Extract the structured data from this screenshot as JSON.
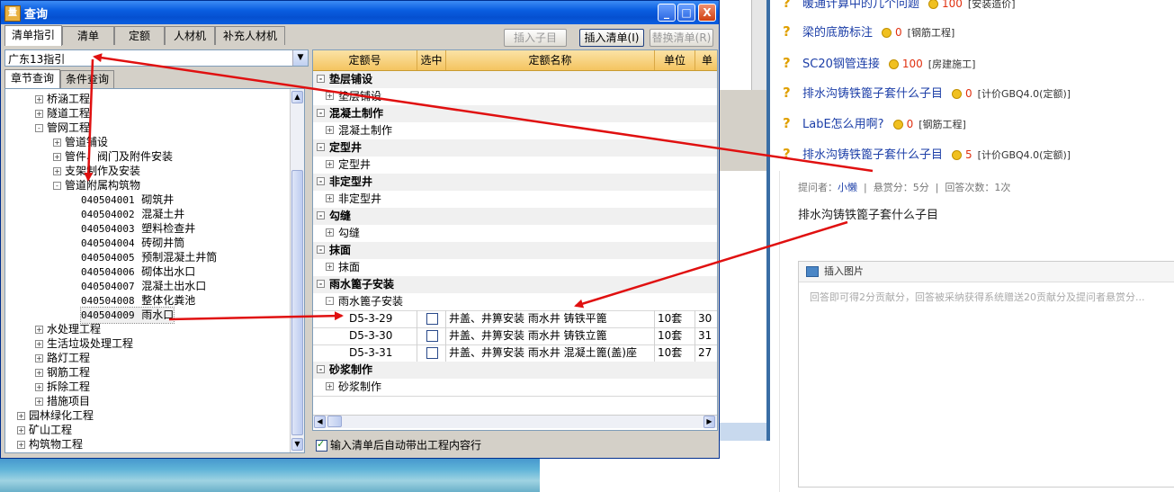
{
  "window": {
    "title": "查询",
    "min_label": "_",
    "max_label": "□",
    "close_label": "X"
  },
  "tabs": [
    "清单指引",
    "清单",
    "定额",
    "人材机",
    "补充人材机"
  ],
  "toolbar": {
    "insert_child": "插入子目",
    "insert_list": "插入清单(I)",
    "replace_list": "替换清单(R)"
  },
  "region_select": "广东13指引",
  "subtabs": [
    "章节查询",
    "条件查询"
  ],
  "tree": [
    {
      "label": "桥涵工程",
      "level": 1,
      "sign": "+"
    },
    {
      "label": "隧道工程",
      "level": 1,
      "sign": "+"
    },
    {
      "label": "管网工程",
      "level": 1,
      "sign": "-"
    },
    {
      "label": "管道铺设",
      "level": 2,
      "sign": "+"
    },
    {
      "label": "管件、阀门及附件安装",
      "level": 2,
      "sign": "+"
    },
    {
      "label": "支架制作及安装",
      "level": 2,
      "sign": "+"
    },
    {
      "label": "管道附属构筑物",
      "level": 2,
      "sign": "-"
    },
    {
      "code": "040504001",
      "label": "砌筑井",
      "level": 3
    },
    {
      "code": "040504002",
      "label": "混凝土井",
      "level": 3
    },
    {
      "code": "040504003",
      "label": "塑料检查井",
      "level": 3
    },
    {
      "code": "040504004",
      "label": "砖砌井筒",
      "level": 3
    },
    {
      "code": "040504005",
      "label": "预制混凝土井筒",
      "level": 3
    },
    {
      "code": "040504006",
      "label": "砌体出水口",
      "level": 3
    },
    {
      "code": "040504007",
      "label": "混凝土出水口",
      "level": 3
    },
    {
      "code": "040504008",
      "label": "整体化粪池",
      "level": 3
    },
    {
      "code": "040504009",
      "label": "雨水口",
      "level": 3,
      "selected": true
    },
    {
      "label": "水处理工程",
      "level": 1,
      "sign": "+"
    },
    {
      "label": "生活垃圾处理工程",
      "level": 1,
      "sign": "+"
    },
    {
      "label": "路灯工程",
      "level": 1,
      "sign": "+"
    },
    {
      "label": "钢筋工程",
      "level": 1,
      "sign": "+"
    },
    {
      "label": "拆除工程",
      "level": 1,
      "sign": "+"
    },
    {
      "label": "措施项目",
      "level": 1,
      "sign": "+"
    },
    {
      "label": "园林绿化工程",
      "level": 0,
      "sign": "+"
    },
    {
      "label": "矿山工程",
      "level": 0,
      "sign": "+"
    },
    {
      "label": "构筑物工程",
      "level": 0,
      "sign": "+"
    }
  ],
  "grid": {
    "headers": [
      "定额号",
      "选中",
      "定额名称",
      "单位",
      "单"
    ],
    "rows": [
      {
        "type": "grp",
        "label": "垫层铺设",
        "sign": "-"
      },
      {
        "type": "sub",
        "label": "垫层铺设",
        "sign": "+"
      },
      {
        "type": "grp",
        "label": "混凝土制作",
        "sign": "-"
      },
      {
        "type": "sub",
        "label": "混凝土制作",
        "sign": "+"
      },
      {
        "type": "grp",
        "label": "定型井",
        "sign": "-"
      },
      {
        "type": "sub",
        "label": "定型井",
        "sign": "+"
      },
      {
        "type": "grp",
        "label": "非定型井",
        "sign": "-"
      },
      {
        "type": "sub",
        "label": "非定型井",
        "sign": "+"
      },
      {
        "type": "grp",
        "label": "勾缝",
        "sign": "-"
      },
      {
        "type": "sub",
        "label": "勾缝",
        "sign": "+"
      },
      {
        "type": "grp",
        "label": "抹面",
        "sign": "-"
      },
      {
        "type": "sub",
        "label": "抹面",
        "sign": "+"
      },
      {
        "type": "grp",
        "label": "雨水篦子安装",
        "sign": "-"
      },
      {
        "type": "sub",
        "label": "雨水篦子安装",
        "sign": "-"
      },
      {
        "type": "item",
        "code": "D5-3-29",
        "name": "井盖、井箅安装 雨水井 铸铁平篦",
        "unit": "10套",
        "price": "30"
      },
      {
        "type": "item",
        "code": "D5-3-30",
        "name": "井盖、井箅安装 雨水井 铸铁立篦",
        "unit": "10套",
        "price": "31"
      },
      {
        "type": "item",
        "code": "D5-3-31",
        "name": "井盖、井箅安装 雨水井 混凝土篦(盖)座",
        "unit": "10套",
        "price": "27"
      },
      {
        "type": "grp",
        "label": "砂浆制作",
        "sign": "-"
      },
      {
        "type": "sub",
        "label": "砂浆制作",
        "sign": "+"
      }
    ]
  },
  "footer_checkbox": "输入清单后自动带出工程内容行",
  "questions": [
    {
      "title": "暖通计算中的几个问题",
      "score": "100",
      "tag": "[安装造价]"
    },
    {
      "title": "梁的底筋标注",
      "score": "0",
      "tag": "[钢筋工程]"
    },
    {
      "title": "SC20钢管连接",
      "score": "100",
      "tag": "[房建施工]"
    },
    {
      "title": "排水沟铸铁篦子套什么子目",
      "score": "0",
      "tag": "[计价GBQ4.0(定额)]"
    },
    {
      "title": "LabE怎么用啊?",
      "score": "0",
      "tag": "[钢筋工程]"
    },
    {
      "title": "排水沟铸铁篦子套什么子目",
      "score": "5",
      "tag": "[计价GBQ4.0(定额)]"
    }
  ],
  "question_meta": {
    "asker_label": "提问者：",
    "asker": "小懒",
    "bounty": "悬赏分：5分",
    "answers": "回答次数：1次"
  },
  "question_body": "排水沟铸铁篦子套什么子目",
  "editor": {
    "insert_image": "插入图片",
    "placeholder": "回答即可得2分贡献分，回答被采纳获得系统赠送20贡献分及提问者悬赏分..."
  },
  "colors": {
    "title_bar": "#0a5ee0",
    "arrow": "#e01010",
    "link": "#1d3fa8",
    "score": "#e03010"
  }
}
